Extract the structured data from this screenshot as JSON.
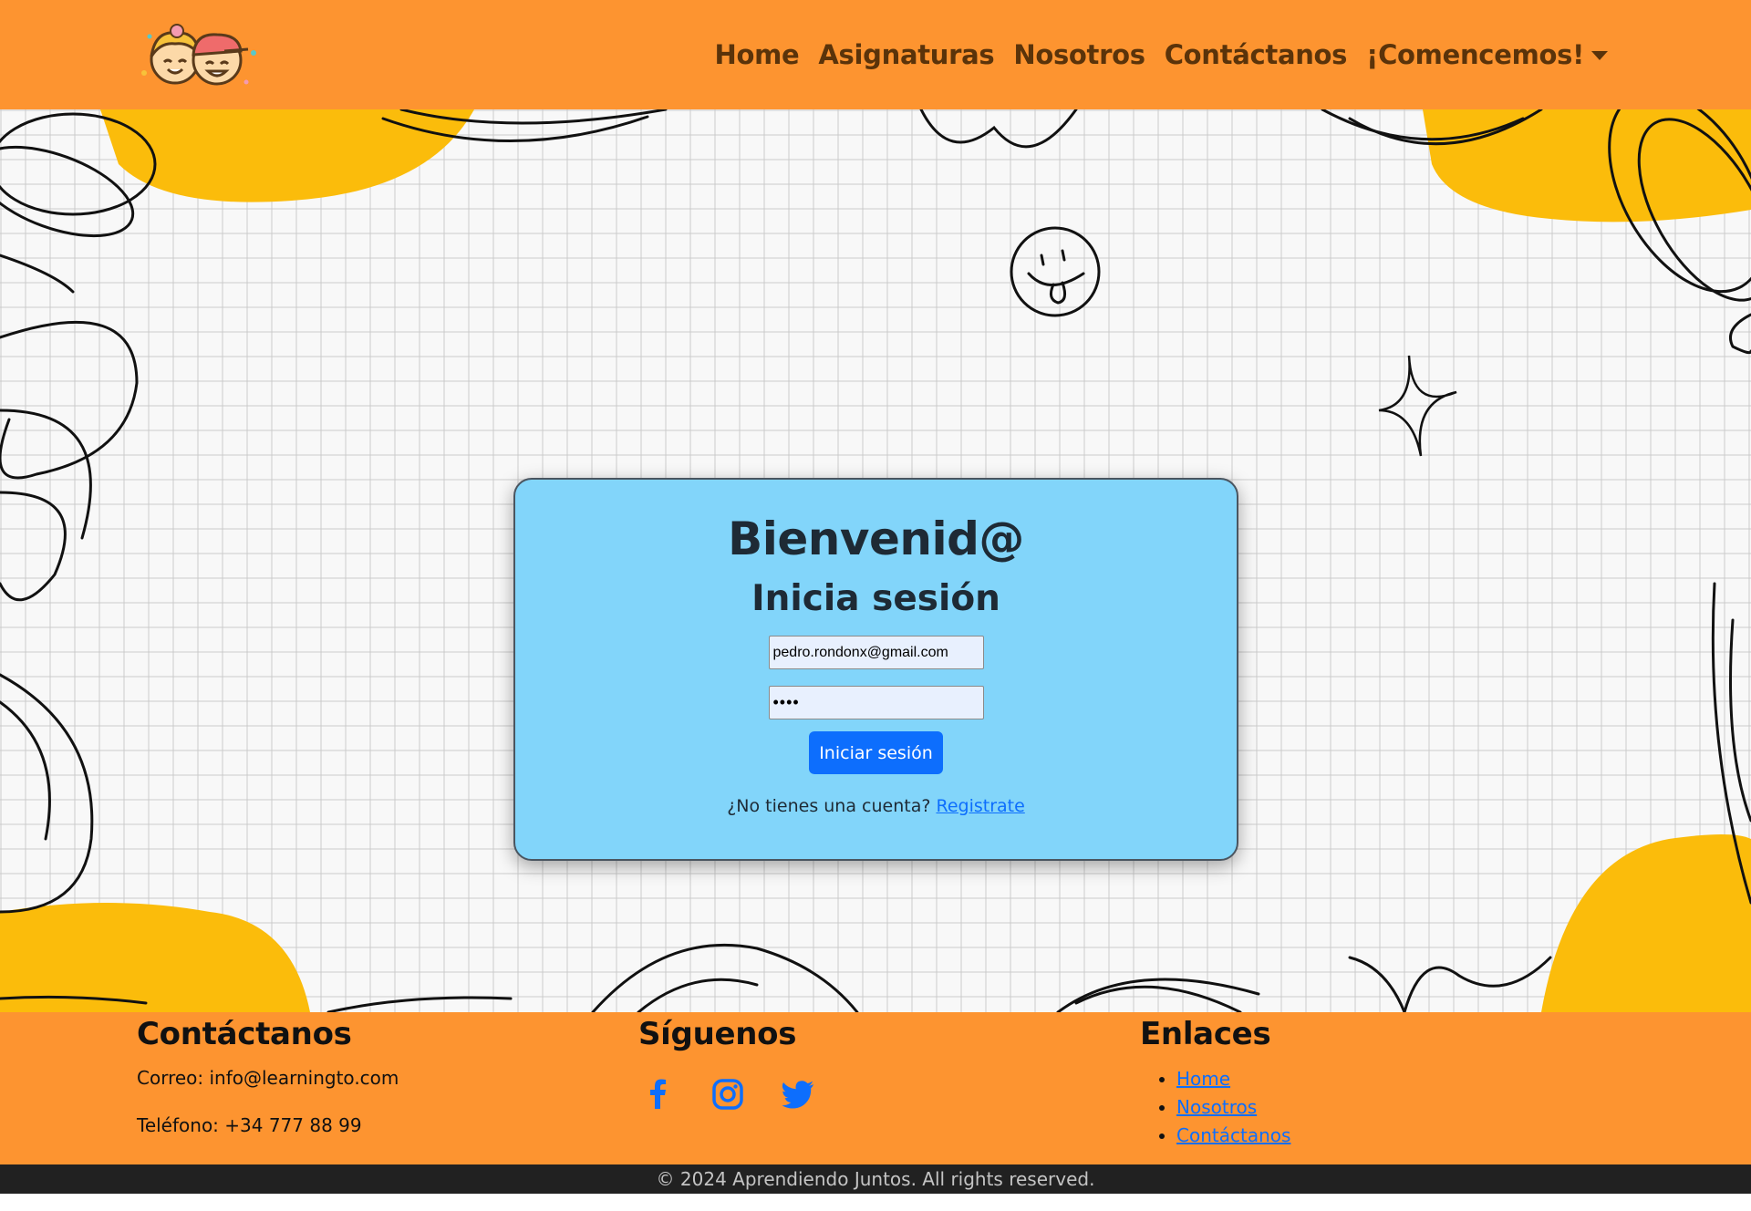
{
  "nav": {
    "logo_icon": "kids-faces-logo",
    "items": [
      {
        "label": "Home"
      },
      {
        "label": "Asignaturas"
      },
      {
        "label": "Nosotros"
      },
      {
        "label": "Contáctanos"
      }
    ],
    "dropdown_label": "¡Comencemos!"
  },
  "login": {
    "title": "Bienvenid@",
    "subtitle": "Inicia sesión",
    "email_value": "pedro.rondonx@gmail.com",
    "password_value": "••••",
    "submit_label": "Iniciar sesión",
    "signup_prompt": "¿No tienes una cuenta?",
    "signup_link": "Registrate"
  },
  "footer": {
    "contact": {
      "heading": "Contáctanos",
      "email": "Correo: info@learningto.com",
      "phone": "Teléfono: +34 777 88 99"
    },
    "social": {
      "heading": "Síguenos",
      "icons": [
        "facebook-icon",
        "instagram-icon",
        "twitter-icon"
      ]
    },
    "links": {
      "heading": "Enlaces",
      "items": [
        "Home",
        "Nosotros",
        "Contáctanos"
      ]
    },
    "copyright": "© 2024 Aprendiendo Juntos. All rights reserved."
  },
  "colors": {
    "nav_bg": "#fd9430",
    "nav_text": "#5a330a",
    "card_bg": "#82d5fa",
    "button_bg": "#0d6efd",
    "accent_yellow": "#fbbc0b",
    "copyright_bg": "#212121"
  }
}
